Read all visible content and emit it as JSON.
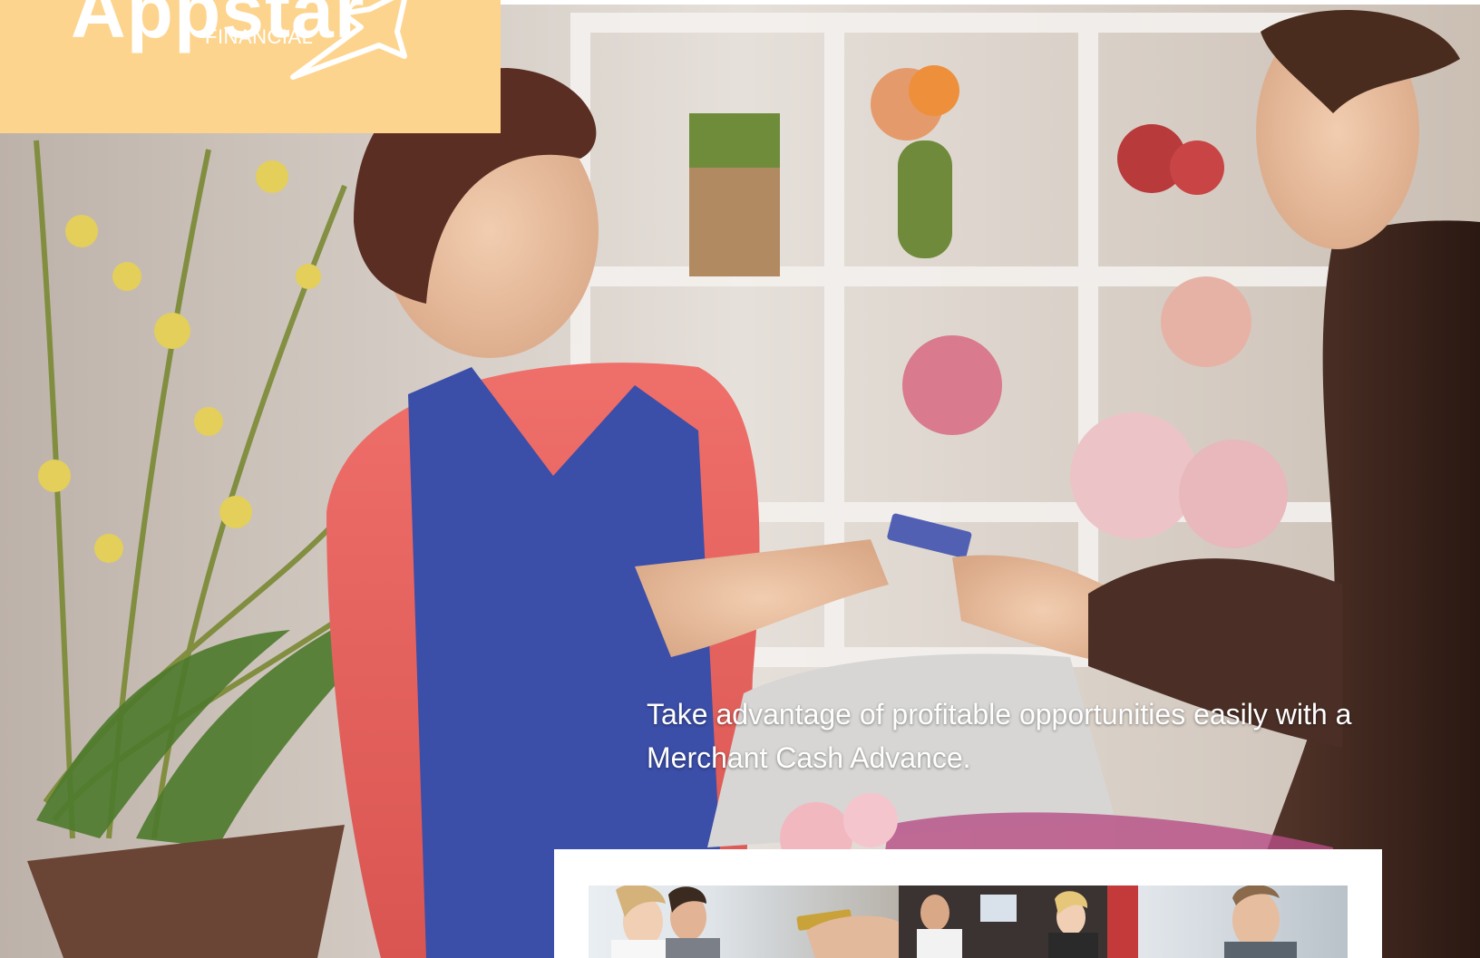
{
  "brand": {
    "name": "Appstar",
    "sub": "FINANCIAL",
    "logo_bg": "#fdd48d",
    "logo_text_color": "#ffffff"
  },
  "hero": {
    "tagline": "Take advantage of profitable opportunities easily with a Merchant Cash Advance.",
    "image": "hero-merchant-card-payment-photo"
  },
  "thumbnails": [
    {
      "image": "thumb-smiling-couple-and-card-handoff"
    },
    {
      "image": "thumb-retail-checkout-team"
    },
    {
      "image": "thumb-smiling-business-owner"
    }
  ]
}
